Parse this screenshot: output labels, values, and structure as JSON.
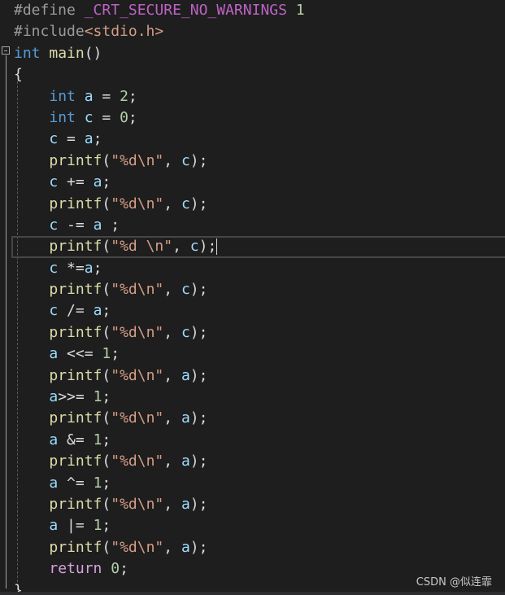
{
  "colors": {
    "background": "#1e1e1e",
    "preprocessor": "#9b9b9b",
    "macro": "#bd63c5",
    "number": "#b5cea8",
    "string": "#d69d85",
    "keyword": "#569cd6",
    "function": "#dcdcaa",
    "variable": "#9cdcfe",
    "control": "#d8a0df"
  },
  "icons": {
    "fold": "collapse-minus-icon"
  },
  "editor": {
    "current_line": 9,
    "lines": [
      [
        {
          "c": "pre",
          "t": "#define "
        },
        {
          "c": "macro",
          "t": "_CRT_SECURE_NO_WARNINGS"
        },
        {
          "c": "plain",
          "t": " "
        },
        {
          "c": "num",
          "t": "1"
        }
      ],
      [
        {
          "c": "pre",
          "t": "#include"
        },
        {
          "c": "str",
          "t": "<stdio.h>"
        }
      ],
      [
        {
          "c": "kw",
          "t": "int"
        },
        {
          "c": "plain",
          "t": " "
        },
        {
          "c": "fn",
          "t": "main"
        },
        {
          "c": "plain",
          "t": "()"
        }
      ],
      [
        {
          "c": "plain",
          "t": "{"
        }
      ],
      [
        {
          "c": "plain",
          "t": "    "
        },
        {
          "c": "kw",
          "t": "int"
        },
        {
          "c": "plain",
          "t": " "
        },
        {
          "c": "var",
          "t": "a"
        },
        {
          "c": "plain",
          "t": " = "
        },
        {
          "c": "num",
          "t": "2"
        },
        {
          "c": "plain",
          "t": ";"
        }
      ],
      [
        {
          "c": "plain",
          "t": "    "
        },
        {
          "c": "kw",
          "t": "int"
        },
        {
          "c": "plain",
          "t": " "
        },
        {
          "c": "var",
          "t": "c"
        },
        {
          "c": "plain",
          "t": " = "
        },
        {
          "c": "num",
          "t": "0"
        },
        {
          "c": "plain",
          "t": ";"
        }
      ],
      [
        {
          "c": "plain",
          "t": "    "
        },
        {
          "c": "var",
          "t": "c"
        },
        {
          "c": "plain",
          "t": " = "
        },
        {
          "c": "var",
          "t": "a"
        },
        {
          "c": "plain",
          "t": ";"
        }
      ],
      [
        {
          "c": "plain",
          "t": "    "
        },
        {
          "c": "fn",
          "t": "printf"
        },
        {
          "c": "plain",
          "t": "("
        },
        {
          "c": "str",
          "t": "\"%d\\n\""
        },
        {
          "c": "plain",
          "t": ", "
        },
        {
          "c": "var",
          "t": "c"
        },
        {
          "c": "plain",
          "t": ");"
        }
      ],
      [
        {
          "c": "plain",
          "t": "    "
        },
        {
          "c": "var",
          "t": "c"
        },
        {
          "c": "plain",
          "t": " += "
        },
        {
          "c": "var",
          "t": "a"
        },
        {
          "c": "plain",
          "t": ";"
        }
      ],
      [
        {
          "c": "plain",
          "t": "    "
        },
        {
          "c": "fn",
          "t": "printf"
        },
        {
          "c": "plain",
          "t": "("
        },
        {
          "c": "str",
          "t": "\"%d\\n\""
        },
        {
          "c": "plain",
          "t": ", "
        },
        {
          "c": "var",
          "t": "c"
        },
        {
          "c": "plain",
          "t": ");"
        }
      ],
      [
        {
          "c": "plain",
          "t": "    "
        },
        {
          "c": "var",
          "t": "c"
        },
        {
          "c": "plain",
          "t": " -= "
        },
        {
          "c": "var",
          "t": "a"
        },
        {
          "c": "plain",
          "t": " ;"
        }
      ],
      [
        {
          "c": "plain",
          "t": "    "
        },
        {
          "c": "fn",
          "t": "printf"
        },
        {
          "c": "plain",
          "t": "("
        },
        {
          "c": "str",
          "t": "\"%d \\n\""
        },
        {
          "c": "plain",
          "t": ", "
        },
        {
          "c": "var",
          "t": "c"
        },
        {
          "c": "plain",
          "t": ");"
        }
      ],
      [
        {
          "c": "plain",
          "t": "    "
        },
        {
          "c": "var",
          "t": "c"
        },
        {
          "c": "plain",
          "t": " *="
        },
        {
          "c": "var",
          "t": "a"
        },
        {
          "c": "plain",
          "t": ";"
        }
      ],
      [
        {
          "c": "plain",
          "t": "    "
        },
        {
          "c": "fn",
          "t": "printf"
        },
        {
          "c": "plain",
          "t": "("
        },
        {
          "c": "str",
          "t": "\"%d\\n\""
        },
        {
          "c": "plain",
          "t": ", "
        },
        {
          "c": "var",
          "t": "c"
        },
        {
          "c": "plain",
          "t": ");"
        }
      ],
      [
        {
          "c": "plain",
          "t": "    "
        },
        {
          "c": "var",
          "t": "c"
        },
        {
          "c": "plain",
          "t": " /= "
        },
        {
          "c": "var",
          "t": "a"
        },
        {
          "c": "plain",
          "t": ";"
        }
      ],
      [
        {
          "c": "plain",
          "t": "    "
        },
        {
          "c": "fn",
          "t": "printf"
        },
        {
          "c": "plain",
          "t": "("
        },
        {
          "c": "str",
          "t": "\"%d\\n\""
        },
        {
          "c": "plain",
          "t": ", "
        },
        {
          "c": "var",
          "t": "c"
        },
        {
          "c": "plain",
          "t": ");"
        }
      ],
      [
        {
          "c": "plain",
          "t": "    "
        },
        {
          "c": "var",
          "t": "a"
        },
        {
          "c": "plain",
          "t": " <<= "
        },
        {
          "c": "num",
          "t": "1"
        },
        {
          "c": "plain",
          "t": ";"
        }
      ],
      [
        {
          "c": "plain",
          "t": "    "
        },
        {
          "c": "fn",
          "t": "printf"
        },
        {
          "c": "plain",
          "t": "("
        },
        {
          "c": "str",
          "t": "\"%d\\n\""
        },
        {
          "c": "plain",
          "t": ", "
        },
        {
          "c": "var",
          "t": "a"
        },
        {
          "c": "plain",
          "t": ");"
        }
      ],
      [
        {
          "c": "plain",
          "t": "    "
        },
        {
          "c": "var",
          "t": "a"
        },
        {
          "c": "plain",
          "t": ">>= "
        },
        {
          "c": "num",
          "t": "1"
        },
        {
          "c": "plain",
          "t": ";"
        }
      ],
      [
        {
          "c": "plain",
          "t": "    "
        },
        {
          "c": "fn",
          "t": "printf"
        },
        {
          "c": "plain",
          "t": "("
        },
        {
          "c": "str",
          "t": "\"%d\\n\""
        },
        {
          "c": "plain",
          "t": ", "
        },
        {
          "c": "var",
          "t": "a"
        },
        {
          "c": "plain",
          "t": ");"
        }
      ],
      [
        {
          "c": "plain",
          "t": "    "
        },
        {
          "c": "var",
          "t": "a"
        },
        {
          "c": "plain",
          "t": " &= "
        },
        {
          "c": "num",
          "t": "1"
        },
        {
          "c": "plain",
          "t": ";"
        }
      ],
      [
        {
          "c": "plain",
          "t": "    "
        },
        {
          "c": "fn",
          "t": "printf"
        },
        {
          "c": "plain",
          "t": "("
        },
        {
          "c": "str",
          "t": "\"%d\\n\""
        },
        {
          "c": "plain",
          "t": ", "
        },
        {
          "c": "var",
          "t": "a"
        },
        {
          "c": "plain",
          "t": ");"
        }
      ],
      [
        {
          "c": "plain",
          "t": "    "
        },
        {
          "c": "var",
          "t": "a"
        },
        {
          "c": "plain",
          "t": " ^= "
        },
        {
          "c": "num",
          "t": "1"
        },
        {
          "c": "plain",
          "t": ";"
        }
      ],
      [
        {
          "c": "plain",
          "t": "    "
        },
        {
          "c": "fn",
          "t": "printf"
        },
        {
          "c": "plain",
          "t": "("
        },
        {
          "c": "str",
          "t": "\"%d\\n\""
        },
        {
          "c": "plain",
          "t": ", "
        },
        {
          "c": "var",
          "t": "a"
        },
        {
          "c": "plain",
          "t": ");"
        }
      ],
      [
        {
          "c": "plain",
          "t": "    "
        },
        {
          "c": "var",
          "t": "a"
        },
        {
          "c": "plain",
          "t": " |= "
        },
        {
          "c": "num",
          "t": "1"
        },
        {
          "c": "plain",
          "t": ";"
        }
      ],
      [
        {
          "c": "plain",
          "t": "    "
        },
        {
          "c": "fn",
          "t": "printf"
        },
        {
          "c": "plain",
          "t": "("
        },
        {
          "c": "str",
          "t": "\"%d\\n\""
        },
        {
          "c": "plain",
          "t": ", "
        },
        {
          "c": "var",
          "t": "a"
        },
        {
          "c": "plain",
          "t": ");"
        }
      ],
      [
        {
          "c": "plain",
          "t": "    "
        },
        {
          "c": "ctl",
          "t": "return"
        },
        {
          "c": "plain",
          "t": " "
        },
        {
          "c": "num",
          "t": "0"
        },
        {
          "c": "plain",
          "t": ";"
        }
      ],
      [
        {
          "c": "plain",
          "t": "}"
        }
      ]
    ]
  },
  "watermark": "CSDN @似连霏"
}
